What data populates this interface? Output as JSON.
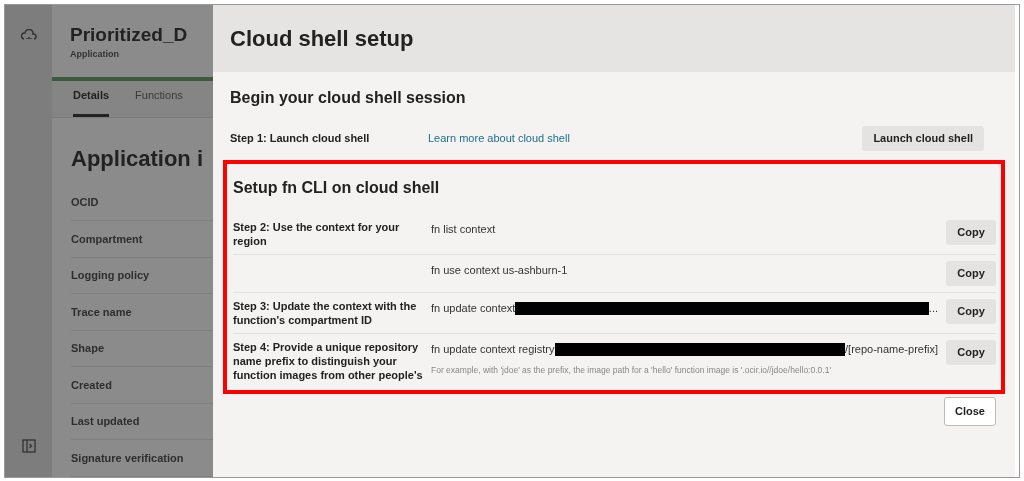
{
  "background_page": {
    "title": "Prioritized_D",
    "subtitle": "Application",
    "tabs": [
      {
        "label": "Details",
        "selected": true
      },
      {
        "label": "Functions",
        "selected": false
      }
    ],
    "section_title": "Application i",
    "fields": [
      "OCID",
      "Compartment",
      "Logging policy",
      "Trace name",
      "Shape",
      "Created",
      "Last updated",
      "Signature verification"
    ]
  },
  "dialog": {
    "title": "Cloud shell setup",
    "session": {
      "heading": "Begin your cloud shell session",
      "step": "Step 1: Launch cloud shell",
      "link": "Learn more about cloud shell",
      "button": "Launch cloud shell"
    },
    "setup": {
      "heading": "Setup fn CLI on cloud shell",
      "highlighted": true,
      "rows": [
        {
          "step": "Step 2: Use the context for your region",
          "command": [
            {
              "kind": "text",
              "text": "fn list context"
            }
          ],
          "button": "Copy"
        },
        {
          "command": [
            {
              "kind": "text",
              "text": "fn use context us-ashburn-1"
            }
          ],
          "button": "Copy"
        },
        {
          "step": "Step 3: Update the context with the function's compartment ID",
          "command": [
            {
              "kind": "text",
              "text": "fn update context"
            },
            {
              "kind": "redacted"
            },
            {
              "kind": "text",
              "text": "..."
            }
          ],
          "button": "Copy"
        },
        {
          "step": "Step 4: Provide a unique repository name prefix to distinguish your function images from other people's",
          "command": [
            {
              "kind": "text",
              "text": "fn update context registry"
            },
            {
              "kind": "redacted"
            },
            {
              "kind": "text",
              "text": "/[repo-name-prefix]"
            }
          ],
          "hint": "For example, with 'jdoe' as the prefix, the image path for a 'hello' function image is '.ocir.io//jdoe/hello:0.0.1'",
          "button": "Copy"
        }
      ]
    },
    "close_button": "Close"
  }
}
